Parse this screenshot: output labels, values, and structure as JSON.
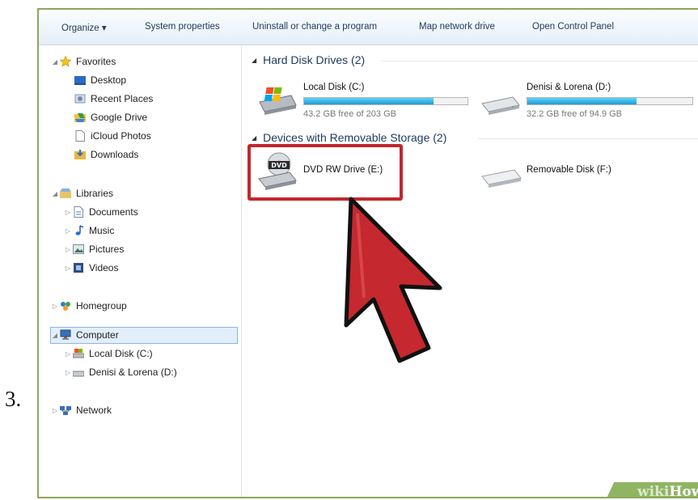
{
  "step": "3.",
  "toolbar": {
    "organize": "Organize ▾",
    "system_properties": "System properties",
    "uninstall": "Uninstall or change a program",
    "map_drive": "Map network drive",
    "control_panel": "Open Control Panel"
  },
  "nav": {
    "favorites": "Favorites",
    "desktop": "Desktop",
    "recent_places": "Recent Places",
    "google_drive": "Google Drive",
    "icloud_photos": "iCloud Photos",
    "downloads": "Downloads",
    "libraries": "Libraries",
    "documents": "Documents",
    "music": "Music",
    "pictures": "Pictures",
    "videos": "Videos",
    "homegroup": "Homegroup",
    "computer": "Computer",
    "local_disk": "Local Disk (C:)",
    "denisi": "Denisi & Lorena (D:)",
    "network": "Network"
  },
  "content": {
    "hard_disk_header": "Hard Disk Drives (2)",
    "removable_header": "Devices with Removable Storage (2)",
    "drive_c": {
      "name": "Local Disk (C:)",
      "free": "43.2 GB free of 203 GB",
      "used_fraction": 0.79
    },
    "drive_d": {
      "name": "Denisi & Lorena (D:)",
      "free": "32.2 GB free of 94.9 GB",
      "used_fraction": 0.66
    },
    "dvd": {
      "name": "DVD RW Drive (E:)",
      "label": "DVD"
    },
    "removable": {
      "name": "Removable Disk (F:)"
    }
  },
  "watermark": {
    "wiki": "wiki",
    "how": "How"
  },
  "colors": {
    "highlight": "#c1272d",
    "bar_fill": "#1d9bd8",
    "selection": "#e2eefc"
  }
}
